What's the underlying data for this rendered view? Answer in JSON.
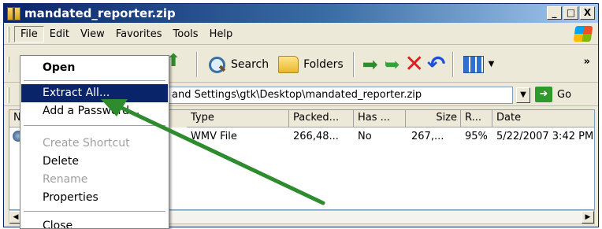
{
  "window": {
    "title": "mandated_reporter.zip",
    "buttons": [
      "_",
      "□",
      "X"
    ]
  },
  "menubar": {
    "items": [
      "File",
      "Edit",
      "View",
      "Favorites",
      "Tools",
      "Help"
    ]
  },
  "toolbar": {
    "search_label": "Search",
    "folders_label": "Folders",
    "more": "»"
  },
  "address": {
    "value": "and Settings\\gtk\\Desktop\\mandated_reporter.zip",
    "go_label": "Go"
  },
  "list": {
    "columns": [
      "N",
      "Type",
      "Packed...",
      "Has ...",
      "Size",
      "R...",
      "Date"
    ],
    "rows": [
      {
        "type": "WMV File",
        "packed": "266,48...",
        "has": "No",
        "size": "267,...",
        "ratio": "95%",
        "date": "5/22/2007 3:42 PM"
      }
    ]
  },
  "context_menu": {
    "items": [
      {
        "label": "Open"
      },
      {
        "label": "Extract All..."
      },
      {
        "label": "Add a Password..."
      },
      {
        "label": "Create Shortcut"
      },
      {
        "label": "Delete"
      },
      {
        "label": "Rename"
      },
      {
        "label": "Properties"
      },
      {
        "label": "Close"
      }
    ]
  },
  "annotation_color": "#2e8b2e"
}
